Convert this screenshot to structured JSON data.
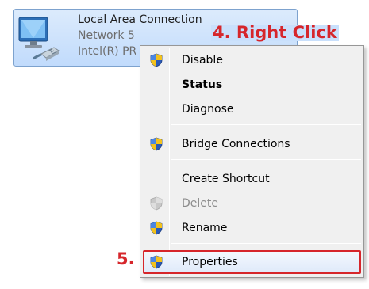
{
  "connection": {
    "name": "Local Area Connection",
    "network": "Network  5",
    "adapter": "Intel(R) PR"
  },
  "annotations": {
    "right_click": "4. Right Click",
    "step_five": "5."
  },
  "menu": {
    "disable": "Disable",
    "status": "Status",
    "diagnose": "Diagnose",
    "bridge": "Bridge Connections",
    "create_shortcut": "Create Shortcut",
    "delete": "Delete",
    "rename": "Rename",
    "properties": "Properties"
  },
  "icons": {
    "shield": "uac-shield-icon",
    "network_adapter": "network-adapter-icon"
  },
  "colors": {
    "annotation": "#d6262b",
    "selection_border": "#7da2ce",
    "menu_background": "#f0f0f0"
  }
}
